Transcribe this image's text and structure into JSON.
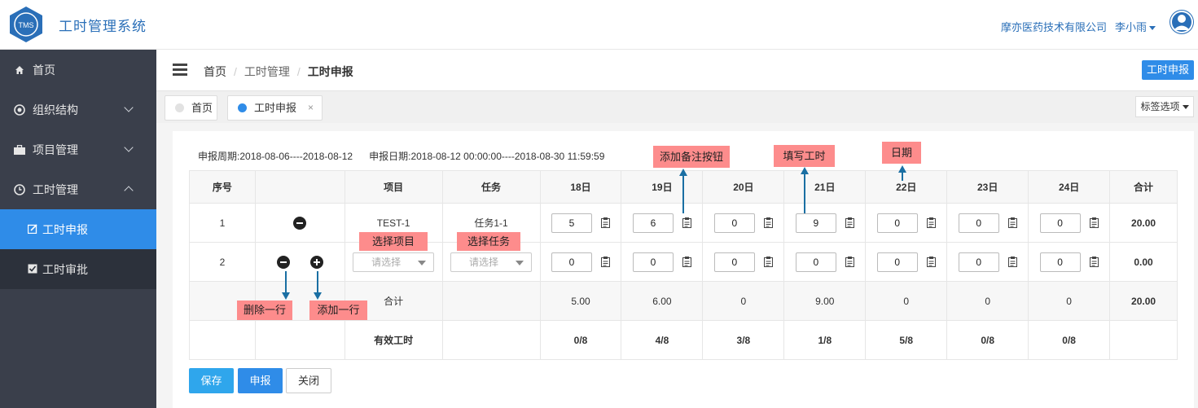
{
  "header": {
    "app_title": "工时管理系统",
    "logo_text": "TMS",
    "company": "摩亦医药技术有限公司",
    "user": "李小雨"
  },
  "sidebar": {
    "items": [
      {
        "label": "首页",
        "icon": "home-icon"
      },
      {
        "label": "组织结构",
        "icon": "org-icon"
      },
      {
        "label": "项目管理",
        "icon": "briefcase-icon"
      },
      {
        "label": "工时管理",
        "icon": "clock-icon"
      }
    ],
    "sub_items": [
      {
        "label": "工时申报",
        "active": true
      },
      {
        "label": "工时审批",
        "active": false
      }
    ]
  },
  "breadcrumb": {
    "home": "首页",
    "section": "工时管理",
    "current": "工时申报",
    "sep": "/"
  },
  "top_button": "工时申报",
  "tabs": {
    "items": [
      {
        "label": "首页",
        "active": false
      },
      {
        "label": "工时申报",
        "active": true
      }
    ],
    "close": "×",
    "options": "标签选项"
  },
  "period": {
    "cycle_label": "申报周期:",
    "cycle": "2018-08-06----2018-08-12",
    "date_label": "申报日期:",
    "dates": "2018-08-12 00:00:00----2018-08-30 11:59:59"
  },
  "table": {
    "headers": [
      "序号",
      "",
      "项目",
      "任务",
      "18日",
      "19日",
      "20日",
      "21日",
      "22日",
      "23日",
      "24日",
      "合计"
    ],
    "rows": [
      {
        "no": "1",
        "project": "TEST-1",
        "task": "任务1-1",
        "hours": [
          "5",
          "6",
          "0",
          "9",
          "0",
          "0",
          "0"
        ],
        "total": "20.00"
      },
      {
        "no": "2",
        "project_placeholder": "请选择",
        "task_placeholder": "请选择",
        "hours": [
          "0",
          "0",
          "0",
          "0",
          "0",
          "0",
          "0"
        ],
        "total": "0.00"
      }
    ],
    "sum_label": "合计",
    "sums": [
      "5.00",
      "6.00",
      "0",
      "9.00",
      "0",
      "0",
      "0"
    ],
    "sum_total": "20.00",
    "effective_label": "有效工时",
    "effective": [
      "0/8",
      "4/8",
      "3/8",
      "1/8",
      "5/8",
      "0/8",
      "0/8"
    ]
  },
  "buttons": {
    "save": "保存",
    "submit": "申报",
    "close": "关闭"
  },
  "annotations": {
    "add_note": "添加备注按钮",
    "fill_hours": "填写工时",
    "date": "日期",
    "select_project": "选择项目",
    "select_task": "选择任务",
    "delete_row": "删除一行",
    "add_row": "添加一行"
  },
  "colors": {
    "primary": "#2f8ce8",
    "sidebar": "#3a3f4b",
    "callout": "#fd8c8c",
    "arrow": "#1a6fa3"
  }
}
